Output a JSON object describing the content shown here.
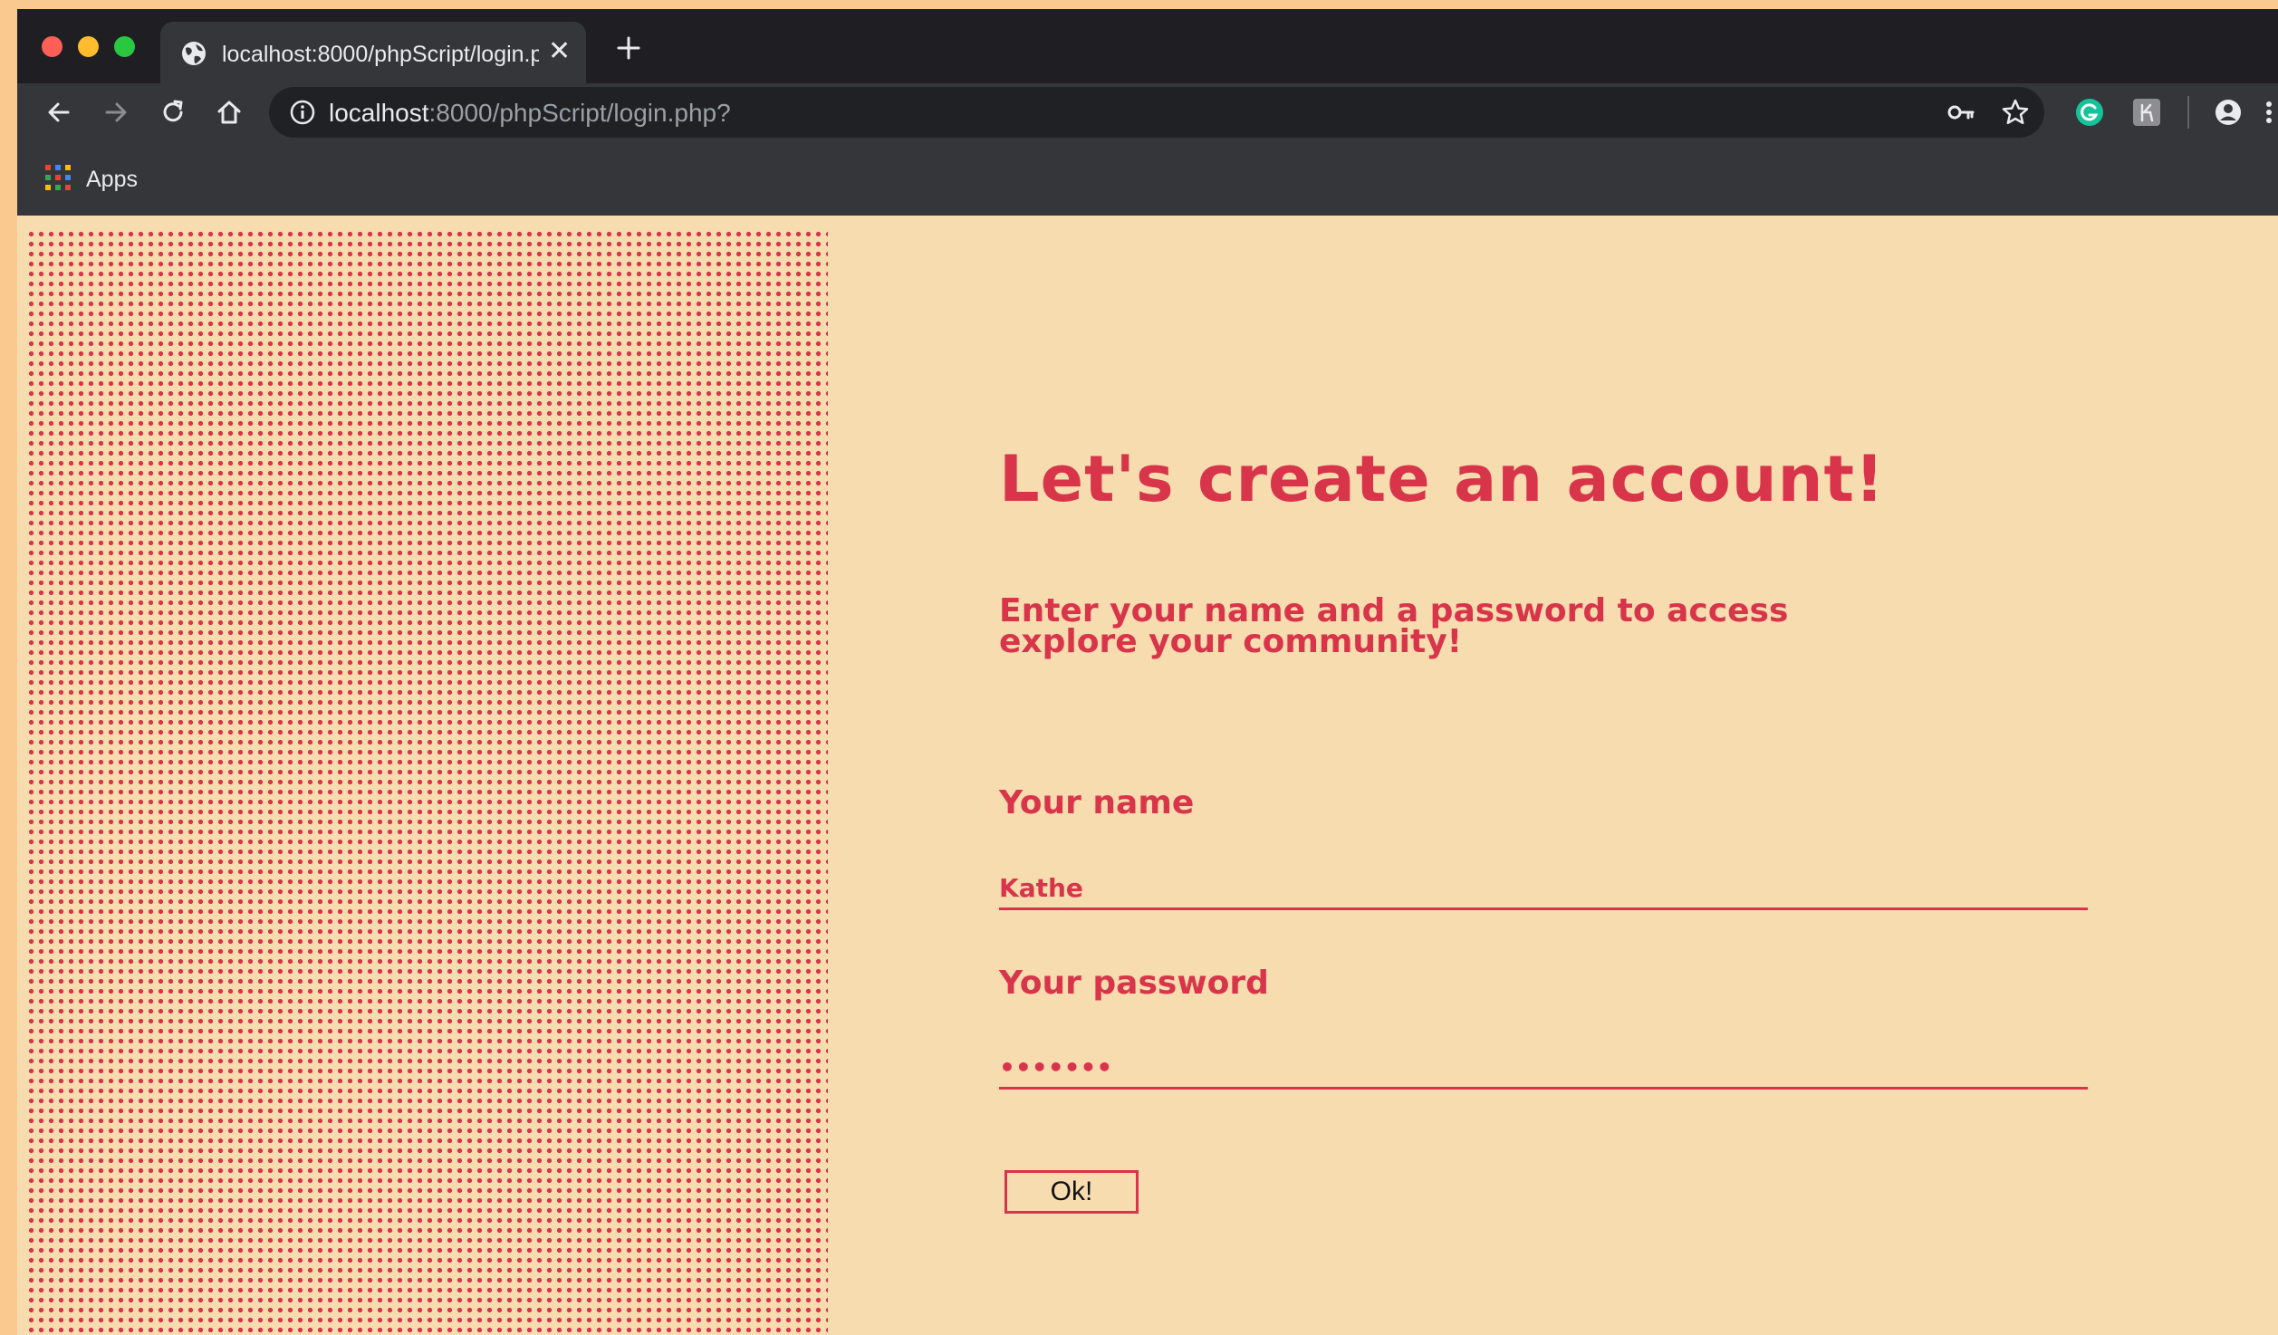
{
  "browser": {
    "tab": {
      "title": "localhost:8000/phpScript/login.php",
      "close_glyph": "✕"
    },
    "new_tab_icon": "plus-icon",
    "address": {
      "host": "localhost",
      "path": ":8000/phpScript/login.php?"
    },
    "bookmarks": {
      "apps_label": "Apps"
    },
    "colors": {
      "tabbar": "#1f1f23",
      "toolbar": "#35363a",
      "omnibox": "#202124"
    }
  },
  "page": {
    "heading": "Let's create an account!",
    "subheading": "Enter your name and a password to access explore your community!",
    "name_label": "Your name",
    "name_value": "Kathe",
    "password_label": "Your password",
    "password_value": "•••••••",
    "submit_label": "Ok!",
    "colors": {
      "accent": "#d8344a",
      "background": "#f7dcb0",
      "outer": "#f9c98f"
    }
  }
}
